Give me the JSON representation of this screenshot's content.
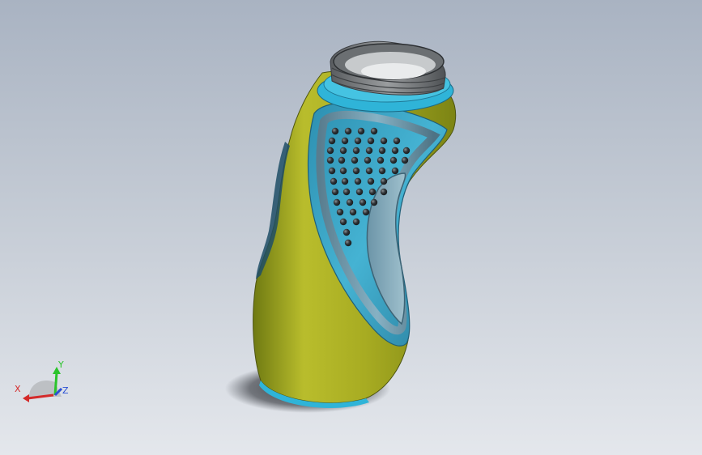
{
  "viewport": {
    "background_top": "#a9b3c2",
    "background_bottom": "#e4e7ec"
  },
  "model": {
    "body_color": "#b3b52a",
    "grip_color": "#3aa7c7",
    "cap_color": "#2fb4d8",
    "nub_color": "#2b2f33"
  },
  "triad": {
    "x_label": "X",
    "y_label": "Y",
    "z_label": "Z",
    "x_color": "#d42a2a",
    "y_color": "#2bc42b",
    "z_color": "#2a4fd4"
  }
}
